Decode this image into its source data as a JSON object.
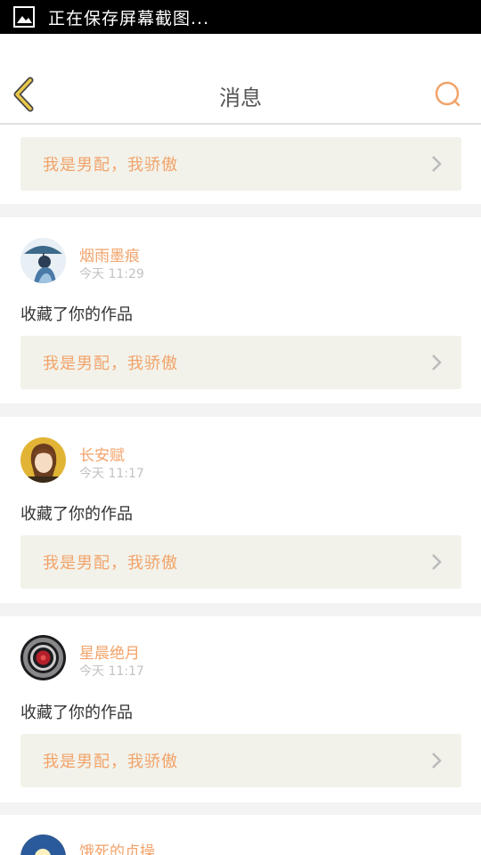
{
  "status_bar": {
    "text": "正在保存屏幕截图..."
  },
  "header": {
    "title": "消息"
  },
  "top_partial": {
    "work_title": "我是男配，我骄傲"
  },
  "messages": [
    {
      "username": "烟雨墨痕",
      "time": "今天 11:29",
      "action": "收藏了你的作品",
      "work_title": "我是男配，我骄傲"
    },
    {
      "username": "长安赋",
      "time": "今天 11:17",
      "action": "收藏了你的作品",
      "work_title": "我是男配，我骄傲"
    },
    {
      "username": "星晨绝月",
      "time": "今天 11:17",
      "action": "收藏了你的作品",
      "work_title": "我是男配，我骄傲"
    },
    {
      "username": "饿死的贞操"
    }
  ],
  "colors": {
    "accent": "#f2a36a",
    "back_arrow": "#e8c74a",
    "link_bg": "#f2f2ea"
  }
}
